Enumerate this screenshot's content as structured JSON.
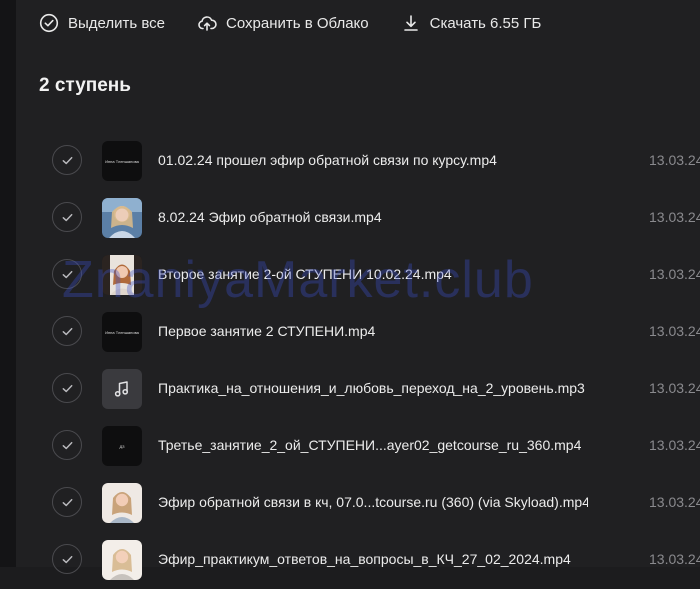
{
  "toolbar": {
    "select_all": "Выделить все",
    "save_cloud": "Сохранить в Облако",
    "download": "Скачать 6.55 ГБ"
  },
  "folder": {
    "title": "2 ступень"
  },
  "files": [
    {
      "name": "01.02.24 прошел эфир обратной связи по курсу.mp4",
      "date": "13.03.24",
      "thumb": "dark-text",
      "thumb_text": "Инна Тлепшанова"
    },
    {
      "name": "8.02.24 Эфир обратной связи.mp4",
      "date": "13.03.24",
      "thumb": "portrait",
      "thumb_text": ""
    },
    {
      "name": "Второе занятие 2-ой СТУПЕНИ 10.02.24.mp4",
      "date": "13.03.24",
      "thumb": "portrait",
      "thumb_text": ""
    },
    {
      "name": "Первое занятие 2 СТУПЕНИ.mp4",
      "date": "13.03.24",
      "thumb": "dark-text",
      "thumb_text": "Инна Тлепшанова"
    },
    {
      "name": "Практика_на_отношения_и_любовь_переход_на_2_уровень.mp3",
      "date": "13.03.24",
      "thumb": "audio",
      "thumb_text": ""
    },
    {
      "name": "Третье_занятие_2_ой_СТУПЕНИ...ayer02_getcourse_ru_360.mp4",
      "date": "13.03.24",
      "thumb": "dark-text",
      "thumb_text": "ДЗ"
    },
    {
      "name": "Эфир обратной связи в кч, 07.0...tcourse.ru (360) (via Skyload).mp4",
      "date": "13.03.24",
      "thumb": "portrait",
      "thumb_text": ""
    },
    {
      "name": "Эфир_практикум_ответов_на_вопросы_в_КЧ_27_02_2024.mp4",
      "date": "13.03.24",
      "thumb": "portrait",
      "thumb_text": ""
    }
  ],
  "watermark": "ZnaniyaMarket.club",
  "colors": {
    "background": "#202022",
    "text": "#ececec",
    "muted": "#8a8a8e",
    "watermark": "#3c50c8"
  },
  "icons": {
    "select_all": "check-circle-icon",
    "save_cloud": "cloud-upload-icon",
    "download": "download-icon",
    "row_check": "check-icon",
    "audio": "music-note-icon"
  }
}
